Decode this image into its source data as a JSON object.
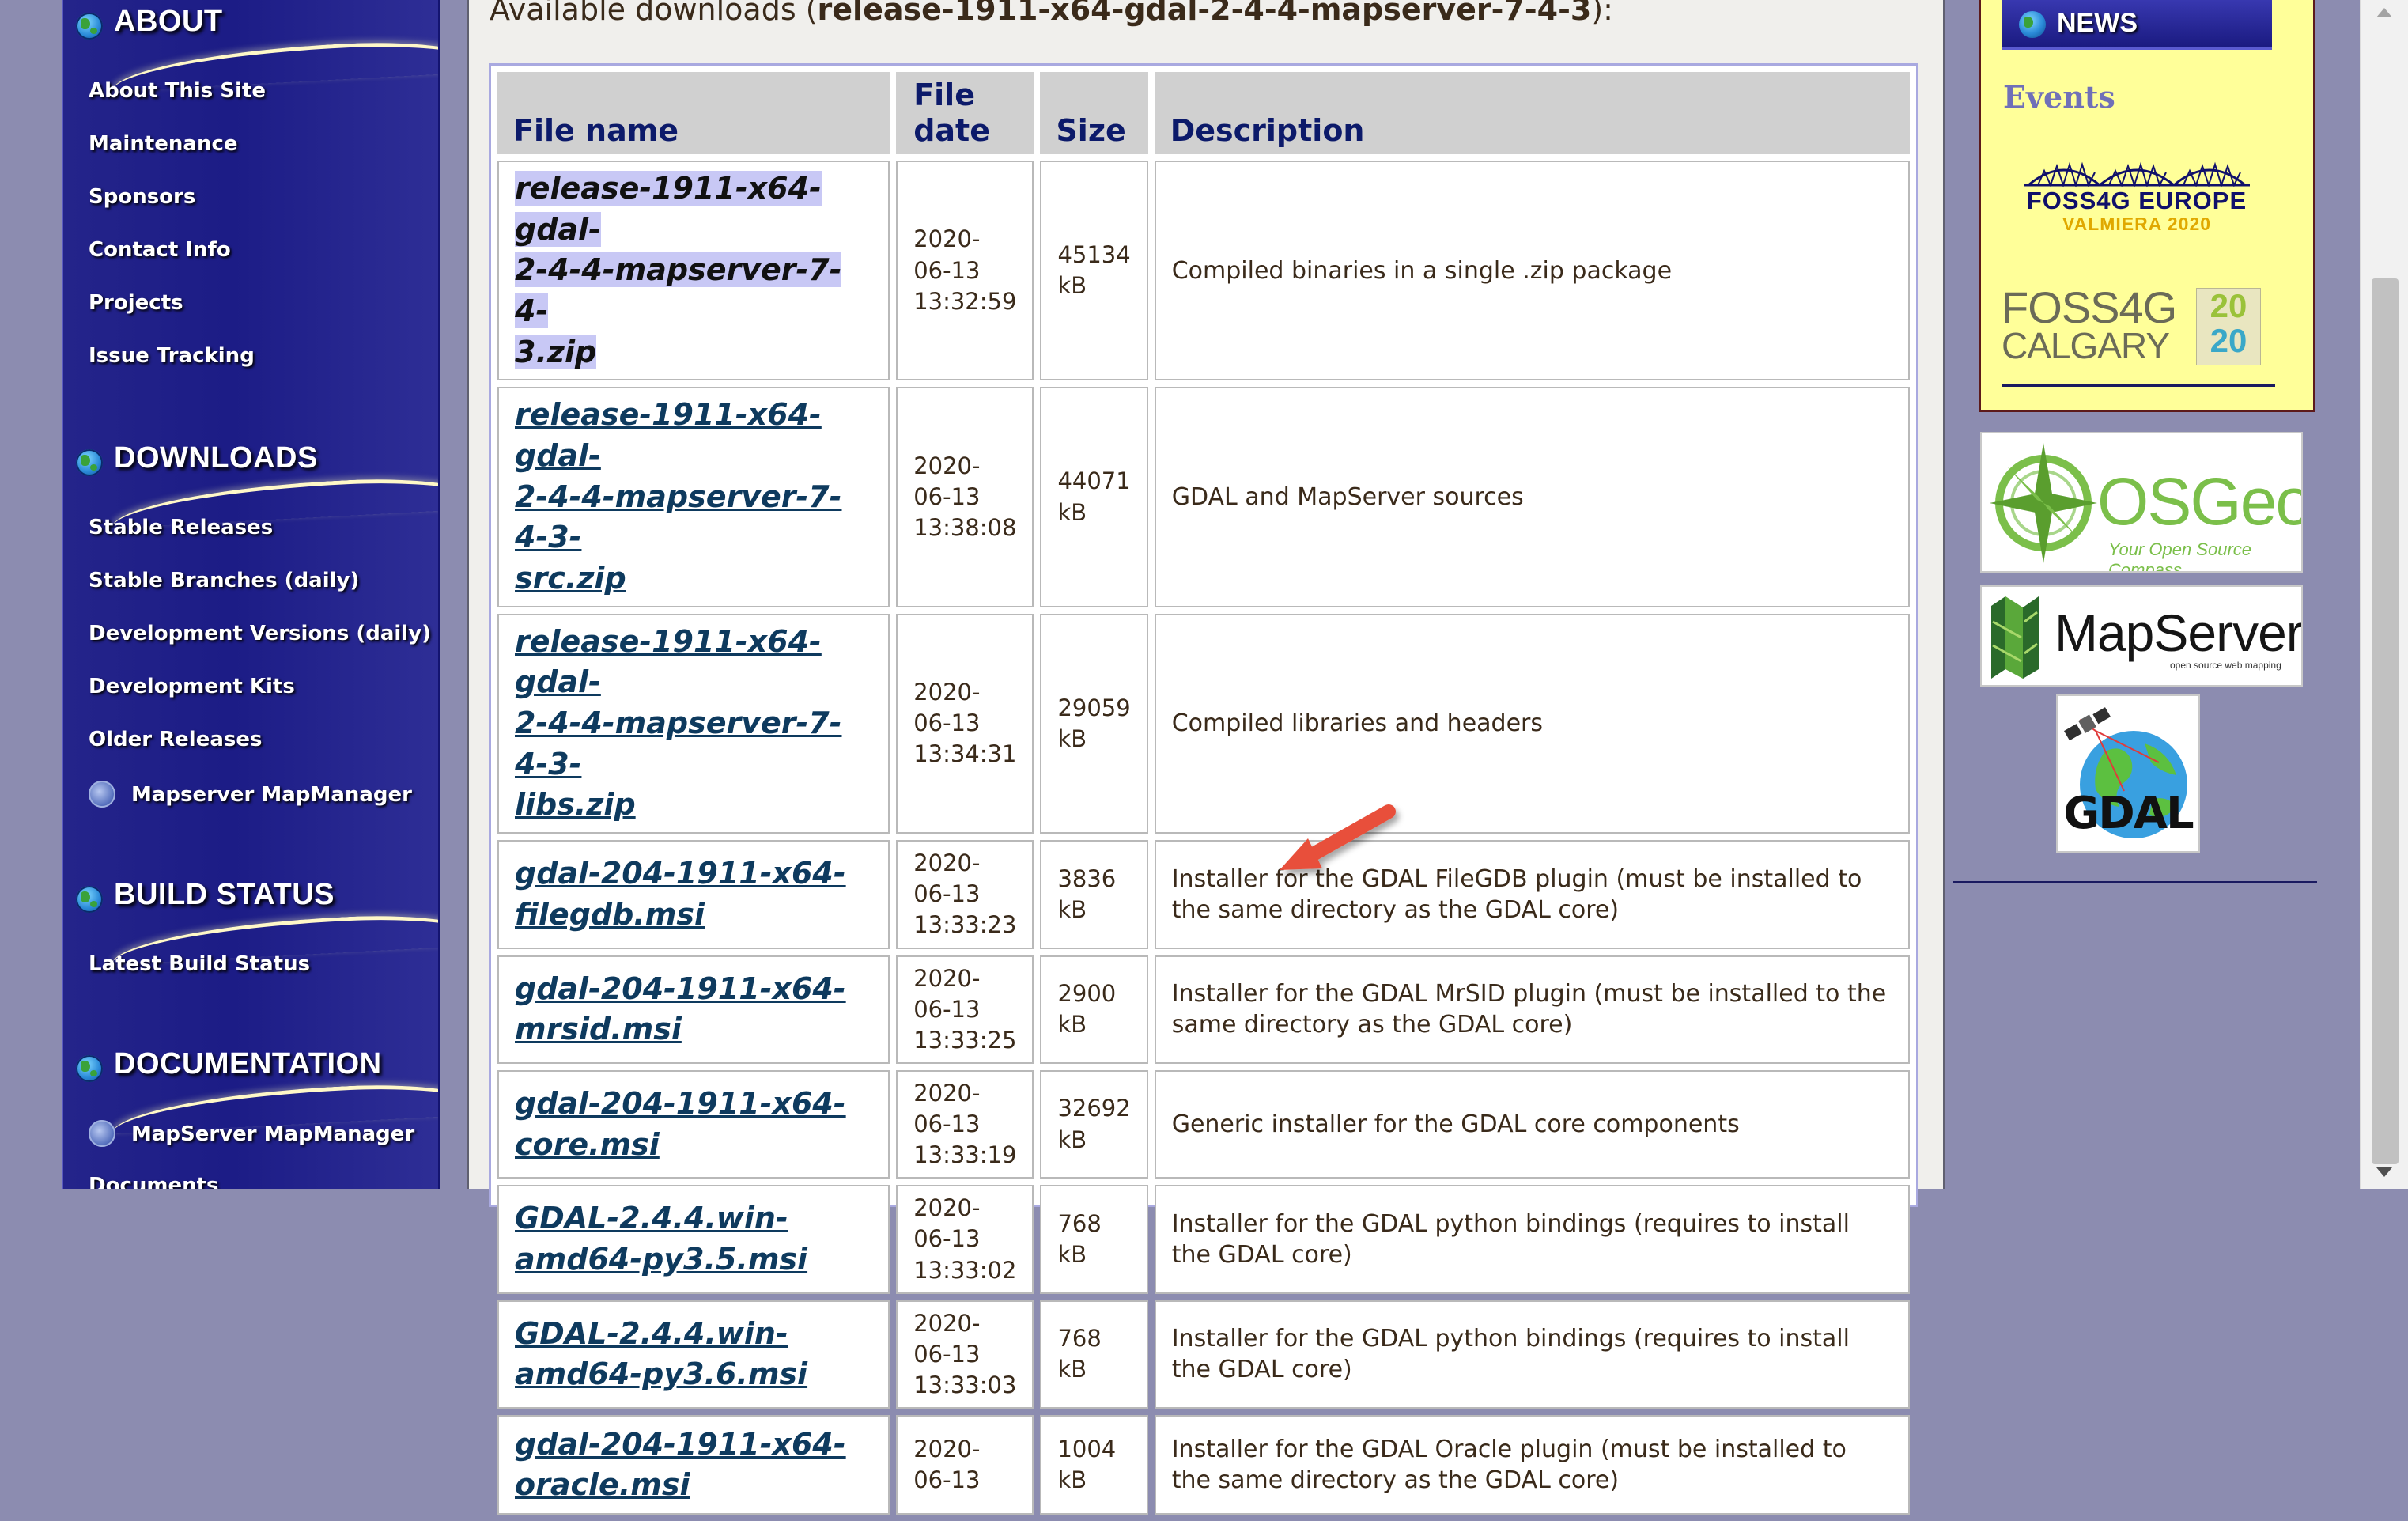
{
  "sidebar": {
    "sections": [
      {
        "title": "ABOUT",
        "items": [
          "About This Site",
          "Maintenance",
          "Sponsors",
          "Contact Info",
          "Projects",
          "Issue Tracking"
        ]
      },
      {
        "title": "DOWNLOADS",
        "items": [
          "Stable Releases",
          "Stable Branches (daily)",
          "Development Versions (daily)",
          "Development Kits",
          "Older Releases",
          "Mapserver MapManager"
        ]
      },
      {
        "title": "BUILD STATUS",
        "items": [
          "Latest Build Status"
        ]
      },
      {
        "title": "DOCUMENTATION",
        "items": [
          "MapServer MapManager",
          "Documents"
        ]
      }
    ]
  },
  "main": {
    "heading_prefix": "Available downloads (",
    "heading_release": "release-1911-x64-gdal-2-4-4-mapserver-7-4-3",
    "heading_suffix": "):",
    "table": {
      "headers": {
        "name": "File name",
        "date": "File date",
        "size": "Size",
        "description": "Description"
      },
      "rows": [
        {
          "name": "release-1911-x64-gdal-2-4-4-mapserver-7-4-3.zip",
          "date": "2020-06-13 13:32:59",
          "size": "45134 kB",
          "description": "Compiled binaries in a single .zip package"
        },
        {
          "name": "release-1911-x64-gdal-2-4-4-mapserver-7-4-3-src.zip",
          "date": "2020-06-13 13:38:08",
          "size": "44071 kB",
          "description": "GDAL and MapServer sources"
        },
        {
          "name": "release-1911-x64-gdal-2-4-4-mapserver-7-4-3-libs.zip",
          "date": "2020-06-13 13:34:31",
          "size": "29059 kB",
          "description": "Compiled libraries and headers"
        },
        {
          "name": "gdal-204-1911-x64-filegdb.msi",
          "date": "2020-06-13 13:33:23",
          "size": "3836 kB",
          "description": "Installer for the GDAL FileGDB plugin (must be installed to the same directory as the GDAL core)"
        },
        {
          "name": "gdal-204-1911-x64-mrsid.msi",
          "date": "2020-06-13 13:33:25",
          "size": "2900 kB",
          "description": "Installer for the GDAL MrSID plugin (must be installed to the same directory as the GDAL core)"
        },
        {
          "name": "gdal-204-1911-x64-core.msi",
          "date": "2020-06-13 13:33:19",
          "size": "32692 kB",
          "description": "Generic installer for the GDAL core components"
        },
        {
          "name": "GDAL-2.4.4.win-amd64-py3.5.msi",
          "date": "2020-06-13 13:33:02",
          "size": "768 kB",
          "description": "Installer for the GDAL python bindings (requires to install the GDAL core)"
        },
        {
          "name": "GDAL-2.4.4.win-amd64-py3.6.msi",
          "date": "2020-06-13 13:33:03",
          "size": "768 kB",
          "description": "Installer for the GDAL python bindings (requires to install the GDAL core)"
        },
        {
          "name": "gdal-204-1911-x64-oracle.msi",
          "date": "2020-06-13",
          "size": "1004 kB",
          "description": "Installer for the GDAL Oracle plugin (must be installed to the same directory as the GDAL core)"
        }
      ]
    }
  },
  "right": {
    "news_title": "NEWS",
    "events_title": "Events",
    "foss4g_europe": {
      "line1": "FOSS4G EUROPE",
      "line2": "VALMIERA 2020"
    },
    "foss4g_calgary": {
      "line1": "FOSS4G",
      "line2": "CALGARY",
      "year_top": "20",
      "year_bottom": "20"
    },
    "osgeo": {
      "name": "OSGeo",
      "tagline": "Your Open Source Compass"
    },
    "mapserver": {
      "name": "MapServer",
      "tagline": "open source web mapping"
    },
    "gdal": {
      "name": "GDAL"
    }
  },
  "colors": {
    "sidebar_bg": "#1c1c86",
    "link": "#0e3a5e",
    "header_text": "#0c1a6a",
    "annotation_arrow": "#e8503a",
    "selection": "#c8c8f5"
  }
}
